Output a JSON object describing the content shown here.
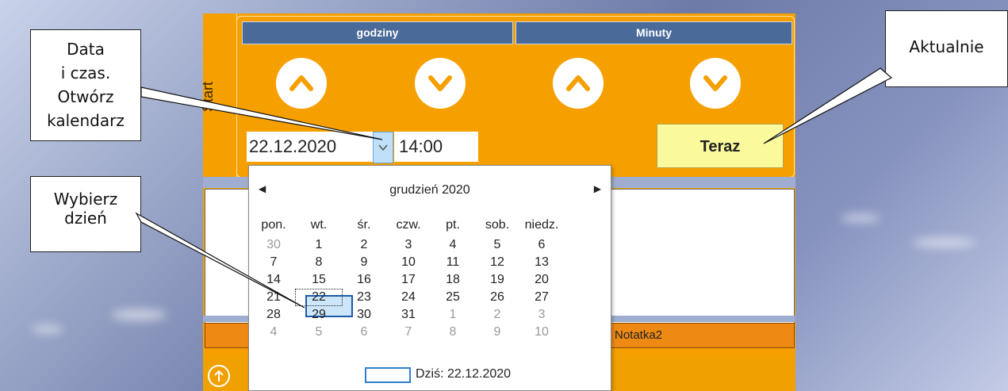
{
  "panel": {
    "start_label": "Start",
    "hours_header": "godziny",
    "minutes_header": "Minuty",
    "date_value": "22.12.2020",
    "time_value": "14:00",
    "now_button": "Teraz",
    "note_label": "Notatka2"
  },
  "calendar": {
    "month_title": "grudzień 2020",
    "weekdays": [
      "pon.",
      "wt.",
      "śr.",
      "czw.",
      "pt.",
      "sob.",
      "niedz."
    ],
    "weeks": [
      [
        "30",
        "1",
        "2",
        "3",
        "4",
        "5",
        "6"
      ],
      [
        "7",
        "8",
        "9",
        "10",
        "11",
        "12",
        "13"
      ],
      [
        "14",
        "15",
        "16",
        "17",
        "18",
        "19",
        "20"
      ],
      [
        "21",
        "22",
        "23",
        "24",
        "25",
        "26",
        "27"
      ],
      [
        "28",
        "29",
        "30",
        "31",
        "1",
        "2",
        "3"
      ],
      [
        "4",
        "5",
        "6",
        "7",
        "8",
        "9",
        "10"
      ]
    ],
    "dim_cells": [
      [
        0,
        0
      ],
      [
        4,
        4
      ],
      [
        4,
        5
      ],
      [
        4,
        6
      ],
      [
        5,
        0
      ],
      [
        5,
        1
      ],
      [
        5,
        2
      ],
      [
        5,
        3
      ],
      [
        5,
        4
      ],
      [
        5,
        5
      ],
      [
        5,
        6
      ]
    ],
    "selected_cell": [
      3,
      1
    ],
    "today_label": "Dziś: 22.12.2020"
  },
  "callouts": {
    "open_calendar": [
      "Data",
      "i czas.",
      "Otwórz",
      "kalendarz"
    ],
    "current": "Aktualnie",
    "pick_day": [
      "Wybierz",
      "dzień"
    ]
  },
  "colors": {
    "panel_orange": "#f5a000",
    "header_blue": "#4a6b9a",
    "now_yellow": "#fafa9c",
    "selection_blue": "#1e5aa8"
  }
}
